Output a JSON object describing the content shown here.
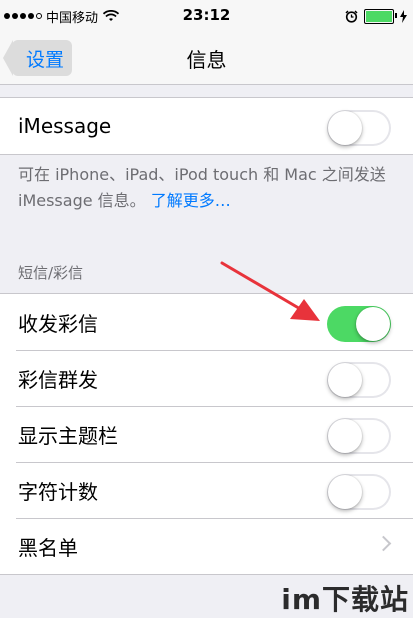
{
  "statusbar": {
    "carrier": "中国移动",
    "time": "23:12",
    "signal_icon": "signal-dots-icon",
    "wifi_icon": "wifi-icon",
    "alarm_icon": "alarm-clock-icon",
    "battery_icon": "battery-icon",
    "charging_icon": "charging-bolt-icon"
  },
  "navbar": {
    "back_label": "设置",
    "title": "信息"
  },
  "imessage": {
    "label": "iMessage",
    "enabled": false,
    "note": "可在 iPhone、iPad、iPod touch 和 Mac 之间发送 iMessage 信息。",
    "learn_more": "了解更多…"
  },
  "sms_section": {
    "header": "短信/彩信",
    "rows": [
      {
        "label": "收发彩信",
        "type": "toggle",
        "enabled": true
      },
      {
        "label": "彩信群发",
        "type": "toggle",
        "enabled": false
      },
      {
        "label": "显示主题栏",
        "type": "toggle",
        "enabled": false
      },
      {
        "label": "字符计数",
        "type": "toggle",
        "enabled": false
      },
      {
        "label": "黑名单",
        "type": "disclosure"
      }
    ]
  },
  "watermark": "im下载站",
  "colors": {
    "accent": "#007aff",
    "toggle_on": "#4cd964",
    "annotation_arrow": "#e8333b"
  }
}
